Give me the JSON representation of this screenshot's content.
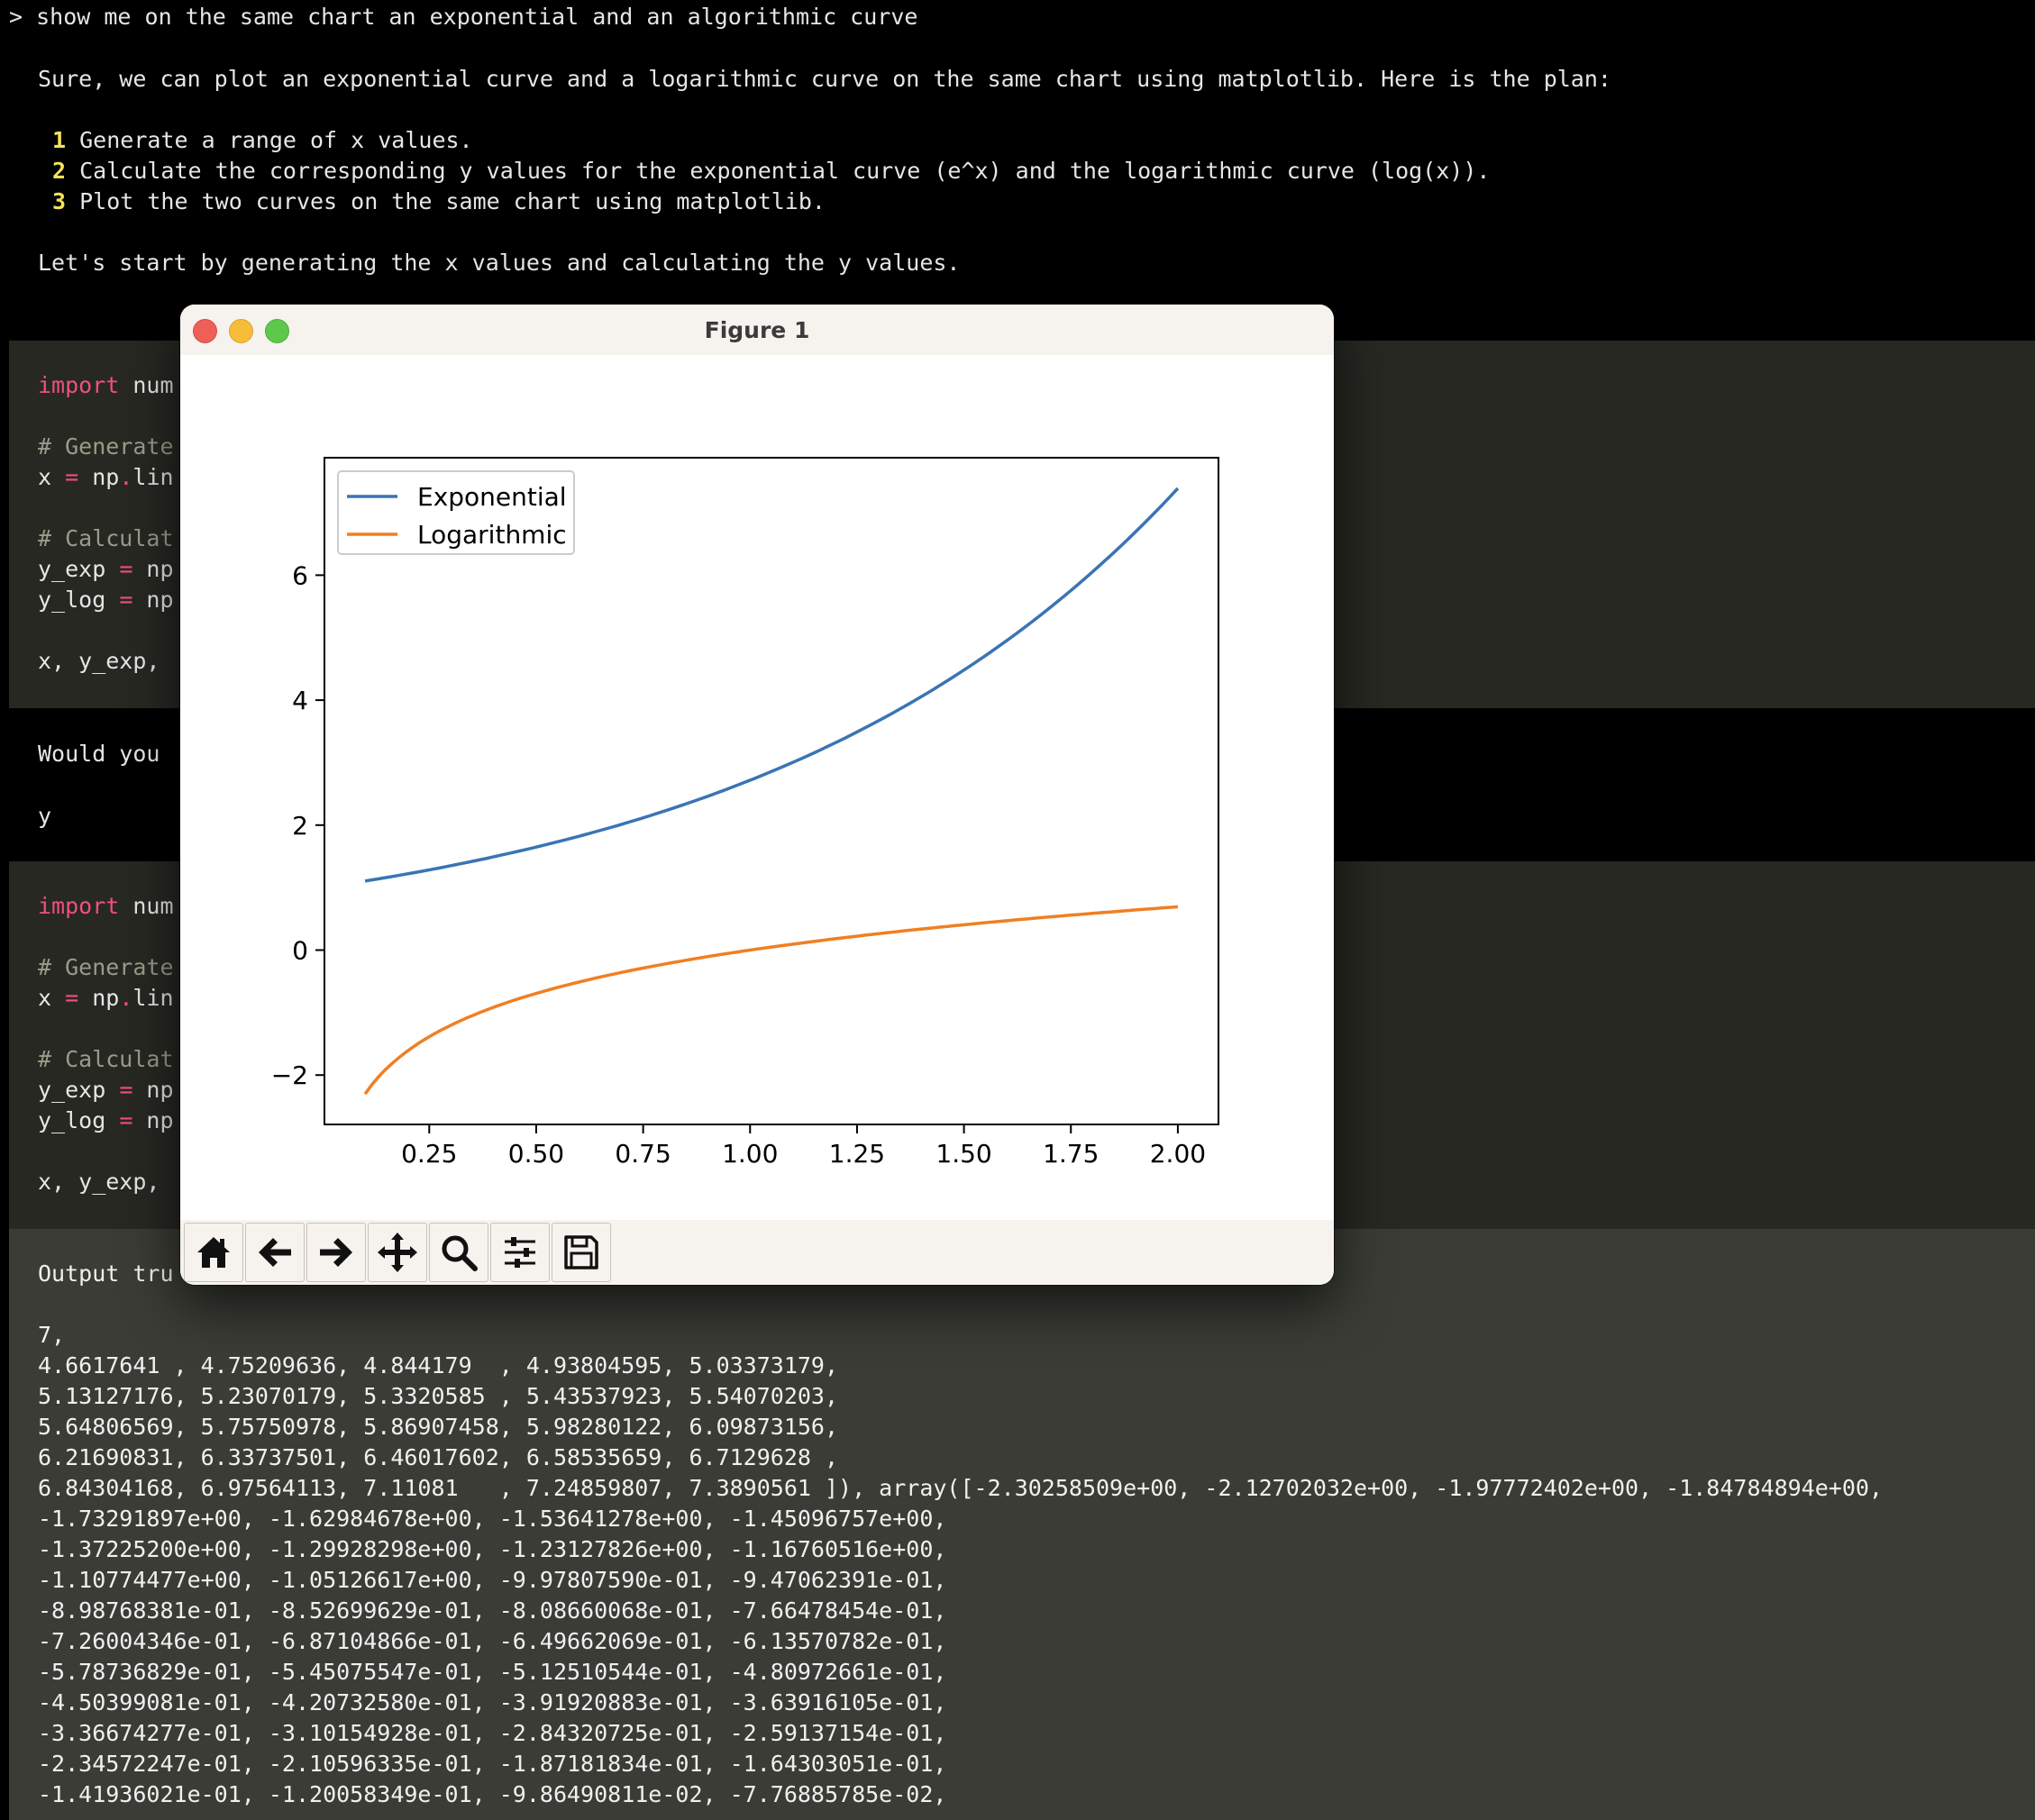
{
  "terminal": {
    "prompt_line": "> show me on the same chart an exponential and an algorithmic curve",
    "intro": "Sure, we can plot an exponential curve and a logarithmic curve on the same chart using matplotlib. Here is the plan:",
    "plan": [
      {
        "n": "1",
        "text": "Generate a range of x values."
      },
      {
        "n": "2",
        "text": "Calculate the corresponding y values for the exponential curve (e^x) and the logarithmic curve (log(x))."
      },
      {
        "n": "3",
        "text": "Plot the two curves on the same chart using matplotlib."
      }
    ],
    "lets_start": "Let's start by generating the x values and calculating the y values.",
    "code_block_1": {
      "import_kw": "import",
      "import_rest": " num",
      "comment_generate": "# Generate",
      "x_line_a": "x ",
      "x_line_eq": "=",
      "x_line_b": " np",
      "x_line_dot": ".",
      "x_line_c": "lin",
      "comment_calc": "# Calculat",
      "yexp_a": "y_exp ",
      "yexp_eq": "=",
      "yexp_b": " np",
      "ylog_a": "y_log ",
      "ylog_eq": "=",
      "ylog_b": " np",
      "return_line": "x, y_exp,"
    },
    "question": "Would you",
    "answer": "y",
    "code_block_2": {
      "import_kw": "import",
      "import_rest": " num",
      "comment_generate": "# Generate",
      "x_line_a": "x ",
      "x_line_eq": "=",
      "x_line_b": " np",
      "x_line_dot": ".",
      "x_line_c": "lin",
      "comment_calc": "# Calculat",
      "yexp_a": "y_exp ",
      "yexp_eq": "=",
      "yexp_b": " np",
      "ylog_a": "y_log ",
      "ylog_eq": "=",
      "ylog_b": " np",
      "return_line": "x, y_exp,"
    },
    "output_header": "Output tru",
    "output_lines": [
      "7,",
      "4.6617641 , 4.75209636, 4.844179  , 4.93804595, 5.03373179,",
      "5.13127176, 5.23070179, 5.3320585 , 5.43537923, 5.54070203,",
      "5.64806569, 5.75750978, 5.86907458, 5.98280122, 6.09873156,",
      "6.21690831, 6.33737501, 6.46017602, 6.58535659, 6.7129628 ,",
      "6.84304168, 6.97564113, 7.11081   , 7.24859807, 7.3890561 ]), array([-2.30258509e+00, -2.12702032e+00, -1.97772402e+00, -1.84784894e+00,",
      "-1.73291897e+00, -1.62984678e+00, -1.53641278e+00, -1.45096757e+00,",
      "-1.37225200e+00, -1.29928298e+00, -1.23127826e+00, -1.16760516e+00,",
      "-1.10774477e+00, -1.05126617e+00, -9.97807590e-01, -9.47062391e-01,",
      "-8.98768381e-01, -8.52699629e-01, -8.08660068e-01, -7.66478454e-01,",
      "-7.26004346e-01, -6.87104866e-01, -6.49662069e-01, -6.13570782e-01,",
      "-5.78736829e-01, -5.45075547e-01, -5.12510544e-01, -4.80972661e-01,",
      "-4.50399081e-01, -4.20732580e-01, -3.91920883e-01, -3.63916105e-01,",
      "-3.36674277e-01, -3.10154928e-01, -2.84320725e-01, -2.59137154e-01,",
      "-2.34572247e-01, -2.10596335e-01, -1.87181834e-01, -1.64303051e-01,",
      "-1.41936021e-01, -1.20058349e-01, -9.86490811e-02, -7.76885785e-02,"
    ]
  },
  "figure": {
    "title": "Figure 1",
    "toolbar": {
      "home": "home-icon",
      "back": "arrow-left-icon",
      "forward": "arrow-right-icon",
      "pan": "move-icon",
      "zoom": "magnifier-icon",
      "configure": "sliders-icon",
      "save": "floppy-icon"
    }
  },
  "chart_data": {
    "type": "line",
    "title": "",
    "xlabel": "",
    "ylabel": "",
    "xlim": [
      0.005,
      2.095
    ],
    "ylim": [
      -2.79,
      7.88
    ],
    "xticks": [
      0.25,
      0.5,
      0.75,
      1.0,
      1.25,
      1.5,
      1.75,
      2.0
    ],
    "xtick_labels": [
      "0.25",
      "0.50",
      "0.75",
      "1.00",
      "1.25",
      "1.50",
      "1.75",
      "2.00"
    ],
    "yticks": [
      -2,
      0,
      2,
      4,
      6
    ],
    "ytick_labels": [
      "−2",
      "0",
      "2",
      "4",
      "6"
    ],
    "grid": false,
    "legend_position": "top-left",
    "series": [
      {
        "name": "Exponential",
        "color": "#3a74b4",
        "x": [
          0.1,
          0.2,
          0.3,
          0.4,
          0.5,
          0.6,
          0.7,
          0.8,
          0.9,
          1.0,
          1.1,
          1.2,
          1.3,
          1.4,
          1.5,
          1.6,
          1.7,
          1.8,
          1.9,
          2.0
        ],
        "y": [
          1.105,
          1.221,
          1.35,
          1.492,
          1.649,
          1.822,
          2.014,
          2.226,
          2.46,
          2.718,
          3.004,
          3.32,
          3.669,
          4.055,
          4.482,
          4.953,
          5.474,
          6.05,
          6.686,
          7.389
        ]
      },
      {
        "name": "Logarithmic",
        "color": "#f07f22",
        "x": [
          0.1,
          0.12,
          0.14,
          0.17,
          0.2,
          0.25,
          0.3,
          0.35,
          0.4,
          0.5,
          0.6,
          0.7,
          0.8,
          0.9,
          1.0,
          1.1,
          1.2,
          1.3,
          1.4,
          1.5,
          1.6,
          1.7,
          1.8,
          1.9,
          2.0
        ],
        "y": [
          -2.303,
          -2.12,
          -1.966,
          -1.772,
          -1.609,
          -1.386,
          -1.204,
          -1.05,
          -0.916,
          -0.693,
          -0.511,
          -0.357,
          -0.223,
          -0.105,
          0.0,
          0.095,
          0.182,
          0.262,
          0.336,
          0.405,
          0.47,
          0.531,
          0.588,
          0.642,
          0.693
        ]
      }
    ]
  }
}
